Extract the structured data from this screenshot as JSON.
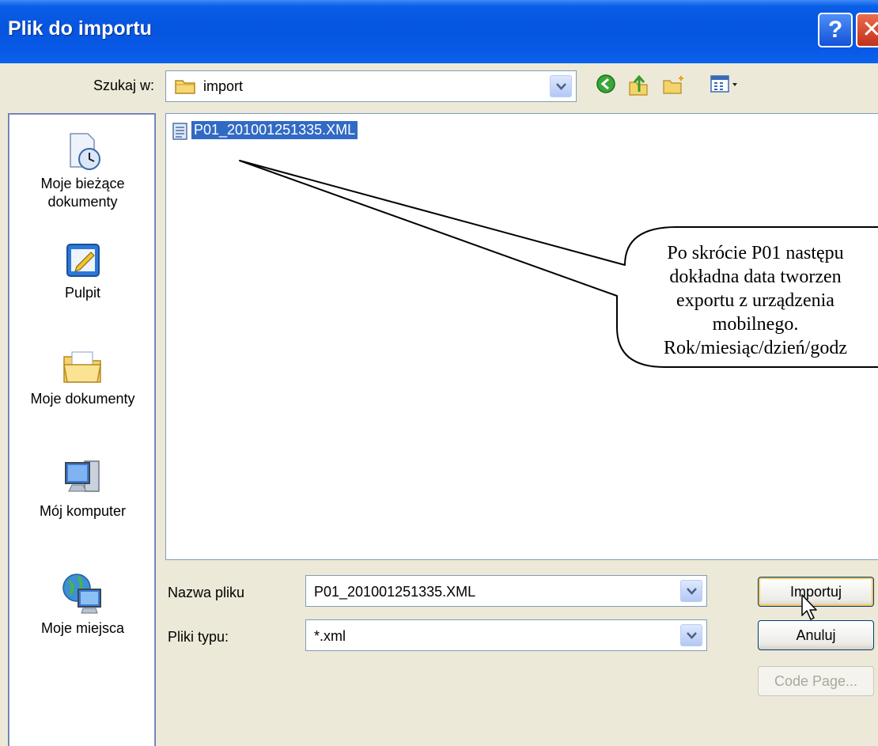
{
  "window": {
    "title": "Plik do importu",
    "help_label": "?",
    "close_label": "✕"
  },
  "look_in": {
    "label": "Szukaj w:",
    "value": "import"
  },
  "toolbar": {
    "icons": [
      "back-icon",
      "up-folder-icon",
      "new-folder-icon",
      "view-menu-icon"
    ]
  },
  "places": [
    {
      "id": "recent",
      "label_lines": [
        "Moje bieżące",
        "dokumenty"
      ],
      "icon": "recent-documents-icon"
    },
    {
      "id": "desktop",
      "label_lines": [
        "Pulpit"
      ],
      "icon": "desktop-icon"
    },
    {
      "id": "documents",
      "label_lines": [
        "Moje dokumenty"
      ],
      "icon": "my-documents-icon"
    },
    {
      "id": "computer",
      "label_lines": [
        "Mój komputer"
      ],
      "icon": "my-computer-icon"
    },
    {
      "id": "network",
      "label_lines": [
        "Moje miejsca"
      ],
      "icon": "my-network-icon"
    }
  ],
  "files": [
    {
      "name": "P01_201001251335.XML",
      "selected": true
    }
  ],
  "callout": {
    "lines": [
      "Po skrócie P01 następu",
      "dokładna data tworzen",
      "exportu z urządzenia",
      "mobilnego.",
      "Rok/miesiąc/dzień/godz"
    ]
  },
  "filename": {
    "label": "Nazwa pliku",
    "value": "P01_201001251335.XML"
  },
  "filetype": {
    "label": "Pliki typu:",
    "value": "*.xml"
  },
  "buttons": {
    "import": "Importuj",
    "cancel": "Anuluj",
    "code_page": "Code Page..."
  },
  "colors": {
    "title_bar": "#0655e0",
    "selection": "#316ac5",
    "dialog_bg": "#ece9d8"
  }
}
